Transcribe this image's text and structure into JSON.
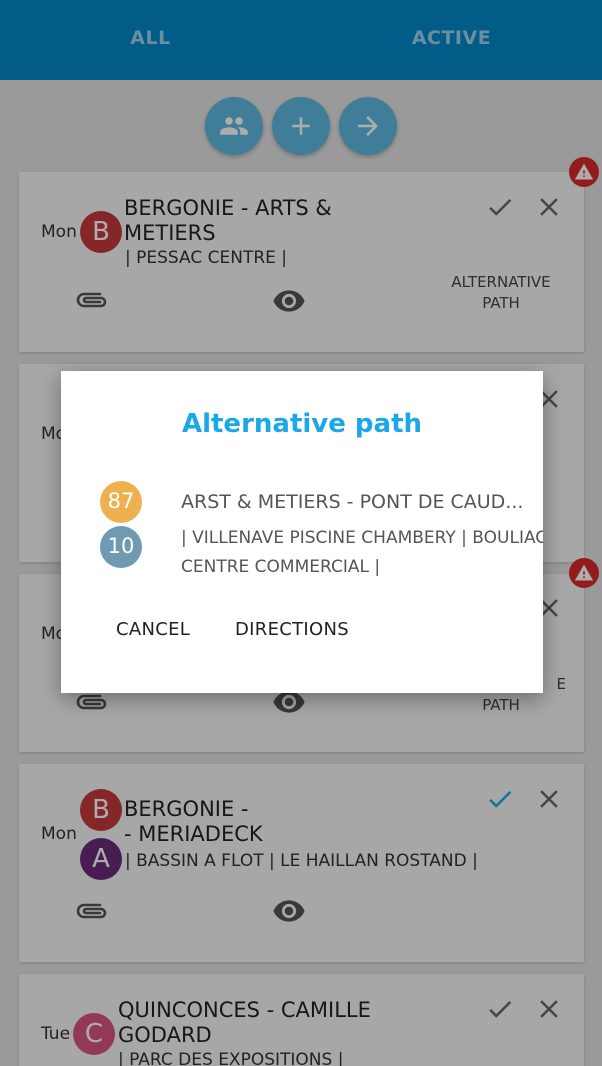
{
  "tabs": [
    {
      "label": "ALL"
    },
    {
      "label": "ACTIVE"
    }
  ],
  "fabs": [
    {
      "icon": "group-icon"
    },
    {
      "icon": "plus-icon"
    },
    {
      "icon": "arrow-right-icon"
    }
  ],
  "cards": [
    {
      "day": "Mon",
      "letters": [
        "B"
      ],
      "title_line1": "BERGONIE - ARTS &",
      "title_line2": "METIERS",
      "stops": "| PESSAC CENTRE |",
      "alt_line1": "ALTERNATIVE",
      "alt_line2": "PATH",
      "warning": true
    },
    {
      "day": "Mo",
      "letters": []
    },
    {
      "day": "Mo",
      "alt_line1": "E",
      "alt_line2": "PATH",
      "warning": true
    },
    {
      "day": "Mon",
      "letters": [
        "B",
        "A"
      ],
      "title_line1": "BERGONIE -",
      "title_line2": "- MERIADECK",
      "stops": "| BASSIN A FLOT | LE HAILLAN ROSTAND |",
      "checked": true
    },
    {
      "day": "Tue",
      "letters": [
        "C"
      ],
      "title_line1": "QUINCONCES - CAMILLE",
      "title_line2": "GODARD",
      "stops": "| PARC DES EXPOSITIONS |"
    }
  ],
  "dialog": {
    "title": "Alternative path",
    "lines": [
      {
        "badge": "87",
        "badge_color": "#efb14f",
        "text": "ARST & METIERS - PONT DE CAUD..."
      },
      {
        "badge": "10",
        "badge_color": "#6f9ab1",
        "text": "| VILLENAVE PISCINE CHAMBERY | BOULIAC"
      },
      {
        "text": "CENTRE COMMERCIAL |"
      }
    ],
    "cancel": "CANCEL",
    "directions": "DIRECTIONS"
  },
  "colors": {
    "primary": "#0288c8",
    "fab": "#5fb8e2",
    "letter_b": "#c5393c",
    "letter_a": "#6b2d7a",
    "letter_c": "#d9547e",
    "check_active": "#1aa8e8",
    "warning": "#d72a2a"
  }
}
